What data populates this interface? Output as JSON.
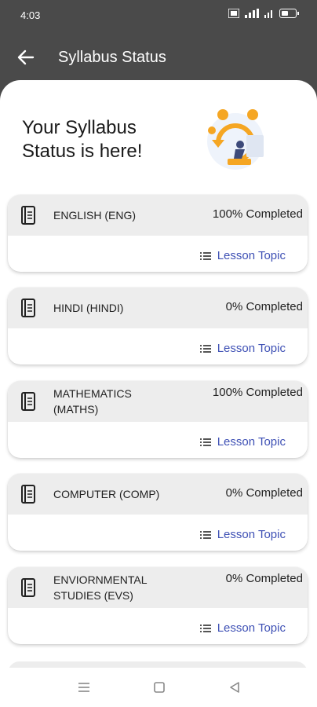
{
  "status_bar": {
    "time": "4:03"
  },
  "app_bar": {
    "title": "Syllabus Status"
  },
  "hero": {
    "title": "Your Syllabus Status is here!"
  },
  "subjects": [
    {
      "name": "ENGLISH (ENG)",
      "status": "100% Completed",
      "link": "Lesson Topic"
    },
    {
      "name": "HINDI (HINDI)",
      "status": "0% Completed",
      "link": "Lesson Topic"
    },
    {
      "name": "MATHEMATICS (MATHS)",
      "status": "100% Completed",
      "link": "Lesson Topic"
    },
    {
      "name": "COMPUTER (COMP)",
      "status": "0% Completed",
      "link": "Lesson Topic"
    },
    {
      "name": "ENVIORNMENTAL STUDIES (EVS)",
      "status": "0% Completed",
      "link": "Lesson Topic"
    }
  ],
  "colors": {
    "accent": "#3f51b5",
    "header_bg": "#4a4a4a",
    "card_head": "#ededed",
    "illustration": "#f5a623"
  },
  "icons": [
    "back-arrow-icon",
    "book-icon",
    "list-icon",
    "menu-nav-icon",
    "home-nav-icon",
    "back-nav-icon"
  ]
}
